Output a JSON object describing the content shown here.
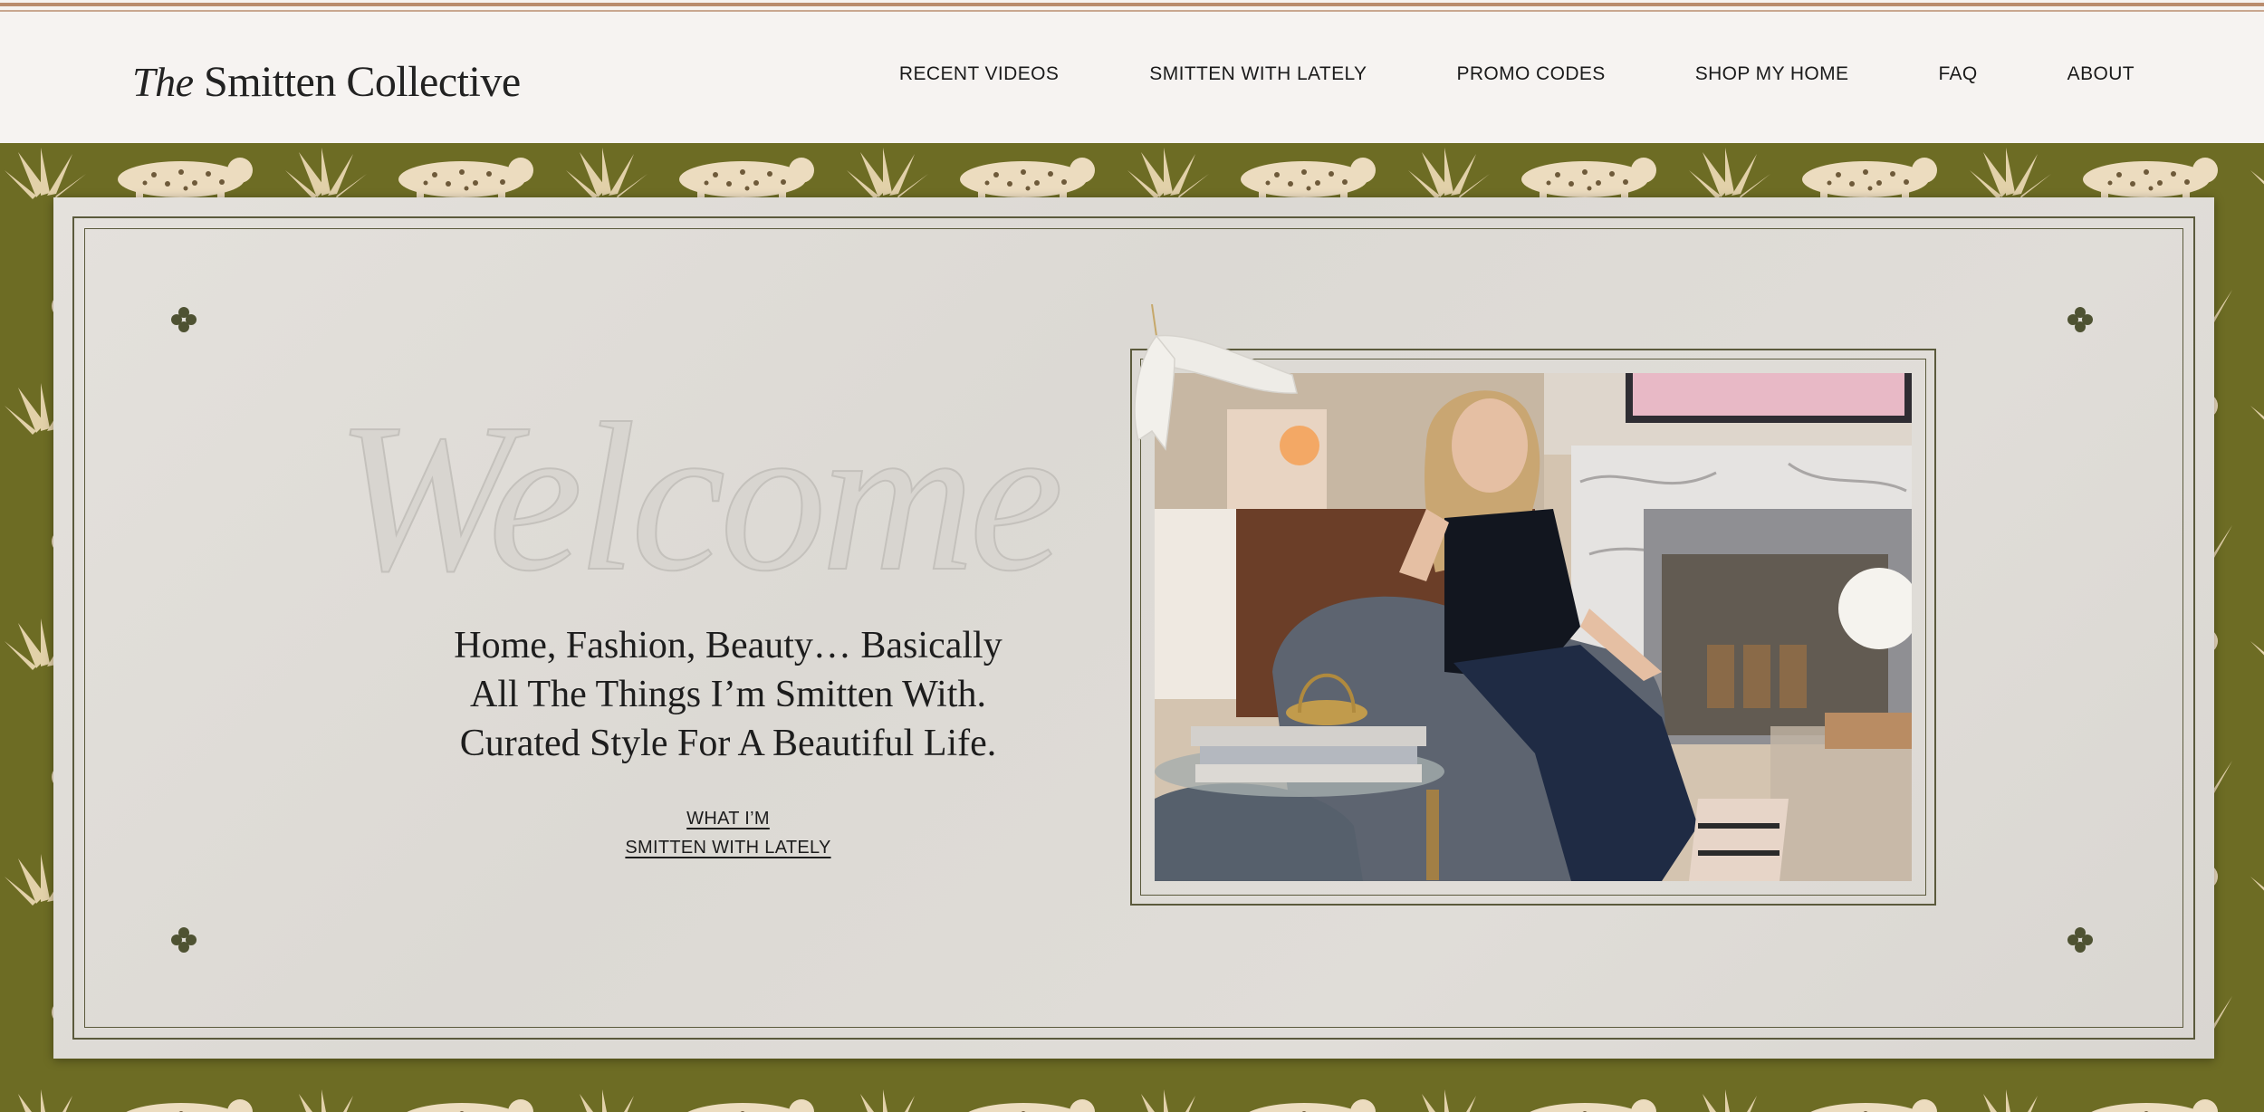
{
  "site": {
    "logo_the": "The",
    "logo_name": "Smitten Collective"
  },
  "nav": {
    "items": [
      {
        "label": "RECENT VIDEOS"
      },
      {
        "label": "SMITTEN WITH LATELY"
      },
      {
        "label": "PROMO CODES"
      },
      {
        "label": "SHOP MY HOME"
      },
      {
        "label": "FAQ"
      },
      {
        "label": "ABOUT"
      }
    ]
  },
  "hero": {
    "welcome_script": "Welcome",
    "tagline": [
      "Home, Fashion, Beauty… Basically",
      "All The Things I’m Smitten With.",
      "Curated Style For A Beautiful Life."
    ],
    "cta": [
      "WHAT I’M",
      "SMITTEN WITH LATELY"
    ]
  },
  "colors": {
    "header_bg": "#f6f3f1",
    "stripe_accent": "#b98c6d",
    "wallpaper_green": "#6d6c24",
    "card_bg": "#e0ddd8",
    "frame_line": "#5b5a3c"
  },
  "icons": {
    "clover": "four-leaf-ornament-icon"
  }
}
